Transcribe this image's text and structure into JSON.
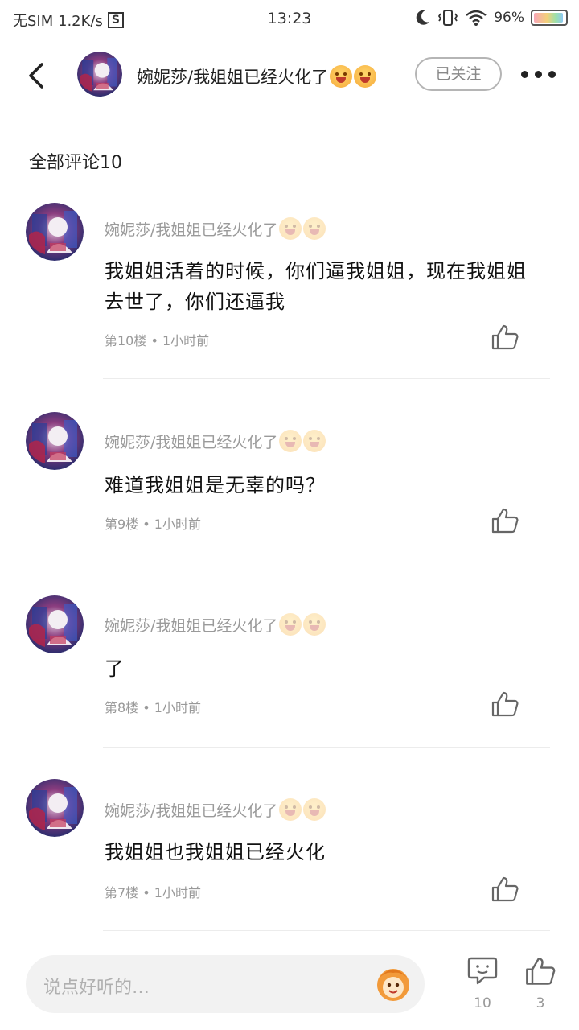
{
  "status_bar": {
    "carrier": "无SIM 1.2K/s",
    "s_badge": "S",
    "time": "13:23",
    "battery_text": "96%",
    "battery_level": 0.96
  },
  "header": {
    "title": "婉妮莎/我姐姐已经火化了",
    "follow_label": "已关注"
  },
  "section_title": "全部评论10",
  "comments": [
    {
      "author": "婉妮莎/我姐姐已经火化了",
      "text": "我姐姐活着的时候，你们逼我姐姐，现在我姐姐去世了，你们还逼我",
      "meta": "第10楼 • 1小时前"
    },
    {
      "author": "婉妮莎/我姐姐已经火化了",
      "text": "难道我姐姐是无辜的吗？",
      "meta": "第9楼 • 1小时前"
    },
    {
      "author": "婉妮莎/我姐姐已经火化了",
      "text": "了",
      "meta": "第8楼 • 1小时前"
    },
    {
      "author": "婉妮莎/我姐姐已经火化了",
      "text": "我姐姐也我姐姐已经火化",
      "meta": "第7楼 • 1小时前"
    }
  ],
  "bottom_bar": {
    "input_placeholder": "说点好听的…",
    "comment_count": "10",
    "like_count": "3"
  },
  "colors": {
    "text_primary": "#111111",
    "text_secondary": "#999999",
    "divider": "#ececec",
    "input_bg": "#f2f2f2"
  }
}
